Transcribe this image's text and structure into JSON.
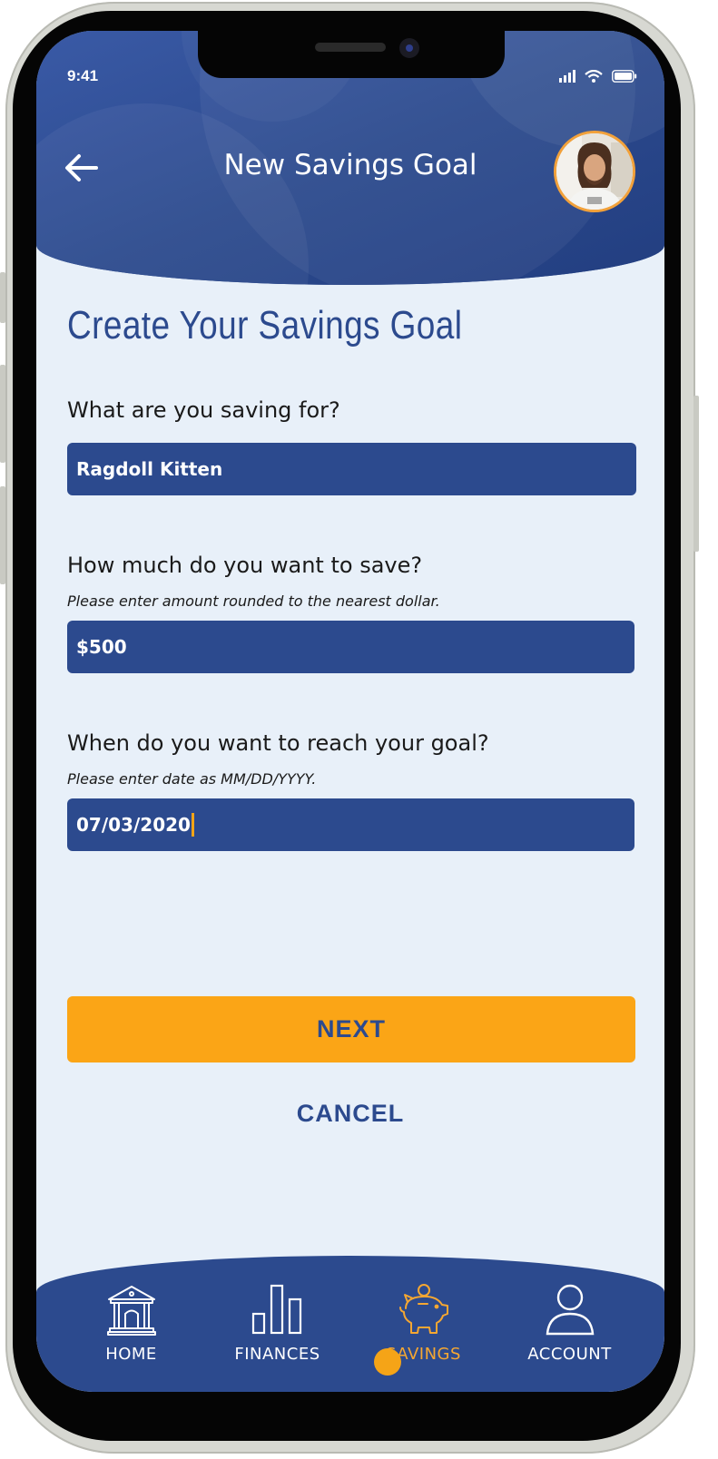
{
  "status_bar": {
    "time": "9:41"
  },
  "header": {
    "title": "New Savings Goal",
    "back_icon": "arrow-left-icon",
    "avatar_icon": "user-avatar"
  },
  "form": {
    "heading": "Create Your Savings Goal",
    "fields": [
      {
        "label": "What are you saving for?",
        "hint": "",
        "value": "Ragdoll Kitten"
      },
      {
        "label": "How much do you want to save?",
        "hint": "Please enter amount rounded to the nearest dollar.",
        "value": "$500"
      },
      {
        "label": "When do you want to reach your goal?",
        "hint": "Please enter date as MM/DD/YYYY.",
        "value": "07/03/2020"
      }
    ]
  },
  "actions": {
    "next_label": "NEXT",
    "cancel_label": "CANCEL"
  },
  "tabbar": {
    "tabs": [
      {
        "label": "HOME",
        "icon": "bank-icon",
        "active": false
      },
      {
        "label": "FINANCES",
        "icon": "bar-chart-icon",
        "active": false
      },
      {
        "label": "SAVINGS",
        "icon": "piggy-bank-icon",
        "active": true
      },
      {
        "label": "ACCOUNT",
        "icon": "user-icon",
        "active": false
      }
    ]
  },
  "colors": {
    "primary": "#2c4a8e",
    "accent": "#fba516",
    "background": "#e8f0f9"
  }
}
